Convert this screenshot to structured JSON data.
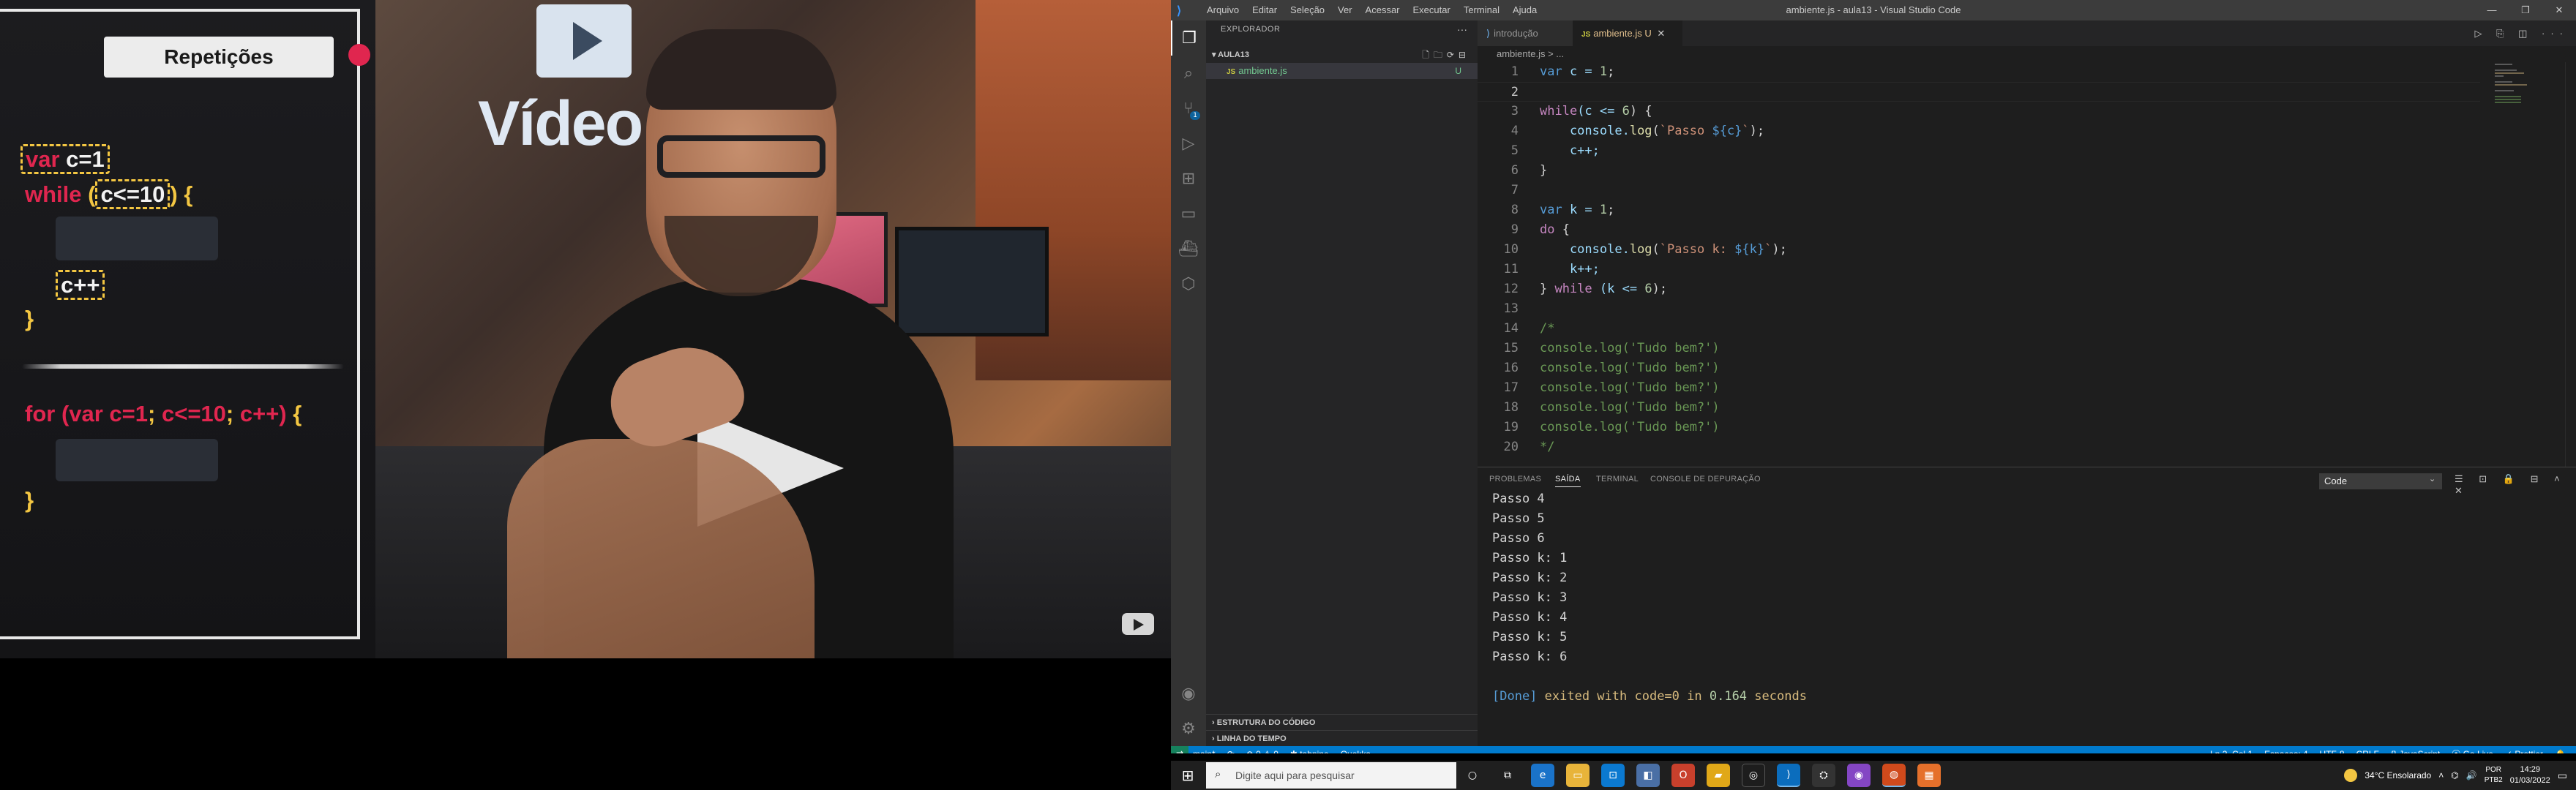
{
  "video": {
    "slide": {
      "title": "Repetições",
      "line1": {
        "kw": "var",
        "rest": "c=1"
      },
      "line2": {
        "kw": "while",
        "cond": "c<=10",
        "brace": "{"
      },
      "line3": "c++",
      "line4": "}",
      "line5": {
        "kw": "for",
        "open": "(var c=1",
        "sep1": ";",
        "cond": " c<=10",
        "sep2": ";",
        "inc": " c++)",
        "brace": "{"
      },
      "line6": "}"
    },
    "camera": {
      "logo_text": "Vídeo"
    },
    "yt_icon": "youtube-play-icon"
  },
  "vscode": {
    "app_icon": "vscode-icon",
    "menu": [
      "Arquivo",
      "Editar",
      "Seleção",
      "Ver",
      "Acessar",
      "Executar",
      "Terminal",
      "Ajuda"
    ],
    "window_title": "ambiente.js - aula13 - Visual Studio Code",
    "window_buttons": [
      "—",
      "❐",
      "✕"
    ],
    "sidebar": {
      "header": "EXPLORADOR",
      "more": "···",
      "folder": "AULA13",
      "folder_actions": "🗋🗀⟳⊟",
      "file": "ambiente.js",
      "file_status": "U",
      "outline": "ESTRUTURA DO CÓDIGO",
      "timeline": "LINHA DO TEMPO"
    },
    "activity": {
      "scm_badge": "1"
    },
    "tabs": [
      {
        "label": "introdução",
        "active": false
      },
      {
        "label": "ambiente.js",
        "active": true,
        "status": "U",
        "close": "✕"
      }
    ],
    "tab_actions": "▷ ⎘ ◫ ···",
    "breadcrumb": "ambiente.js > ...",
    "code": [
      {
        "n": "1"
      },
      {
        "n": "2"
      },
      {
        "n": "3"
      },
      {
        "n": "4"
      },
      {
        "n": "5"
      },
      {
        "n": "6"
      },
      {
        "n": "7"
      },
      {
        "n": "8"
      },
      {
        "n": "9"
      },
      {
        "n": "10"
      },
      {
        "n": "11"
      },
      {
        "n": "12"
      },
      {
        "n": "13"
      },
      {
        "n": "14"
      },
      {
        "n": "15"
      },
      {
        "n": "16"
      },
      {
        "n": "17"
      },
      {
        "n": "18"
      },
      {
        "n": "19"
      },
      {
        "n": "20"
      }
    ],
    "code_text": {
      "l1": [
        "var",
        " c = ",
        "1",
        ";"
      ],
      "l3": [
        "while",
        "(c <= ",
        "6",
        ") {"
      ],
      "l4": [
        "    console.",
        "log",
        "(",
        "`Passo ",
        "${c}",
        "`",
        ");"
      ],
      "l5": "    c++;",
      "l6": "}",
      "l8": [
        "var",
        " k = ",
        "1",
        ";"
      ],
      "l9": [
        "do",
        " {"
      ],
      "l10": [
        "    console.",
        "log",
        "(",
        "`Passo k: ",
        "${k}",
        "`",
        ");"
      ],
      "l11": "    k++;",
      "l12": [
        "} ",
        "while",
        " (k <= ",
        "6",
        ");"
      ],
      "l14": "/*",
      "l15": "console.log('Tudo bem?')",
      "l16": "console.log('Tudo bem?')",
      "l17": "console.log('Tudo bem?')",
      "l18": "console.log('Tudo bem?')",
      "l19": "console.log('Tudo bem?')",
      "l20": "*/"
    },
    "panel": {
      "tabs": [
        "PROBLEMAS",
        "SAÍDA",
        "TERMINAL",
        "CONSOLE DE DEPURAÇÃO"
      ],
      "active_tab": "SAÍDA",
      "output_channel": "Code",
      "actions": "☰ ⊡ 🔒 ⊟ ˄ ✕",
      "output": [
        "Passo 4",
        "Passo 5",
        "Passo 6",
        "Passo k: 1",
        "Passo k: 2",
        "Passo k: 3",
        "Passo k: 4",
        "Passo k: 5",
        "Passo k: 6"
      ],
      "done": {
        "tag": "[Done]",
        "text1": " exited with ",
        "code": "code=0",
        "text2": " in ",
        "time": "0.164",
        "text3": " seconds"
      }
    },
    "status": {
      "remote": "⇄",
      "branch": "main*",
      "sync": "⟳",
      "problems": "⊗ 0 ⚠ 0",
      "tabnine": "✱ tabnine",
      "quokka": "Quokka",
      "position": "Ln 2, Col 1",
      "spaces": "Espaços: 4",
      "encoding": "UTF-8",
      "eol": "CRLF",
      "language": "{} JavaScript",
      "golive": "⦿ Go Live",
      "prettier": "✓ Prettier",
      "bell": "🔔"
    }
  },
  "taskbar": {
    "search_placeholder": "Digite aqui para pesquisar",
    "weather": "34°C Ensolarado",
    "lang1": "POR",
    "lang2": "PTB2",
    "time": "14:29",
    "date": "01/03/2022"
  }
}
